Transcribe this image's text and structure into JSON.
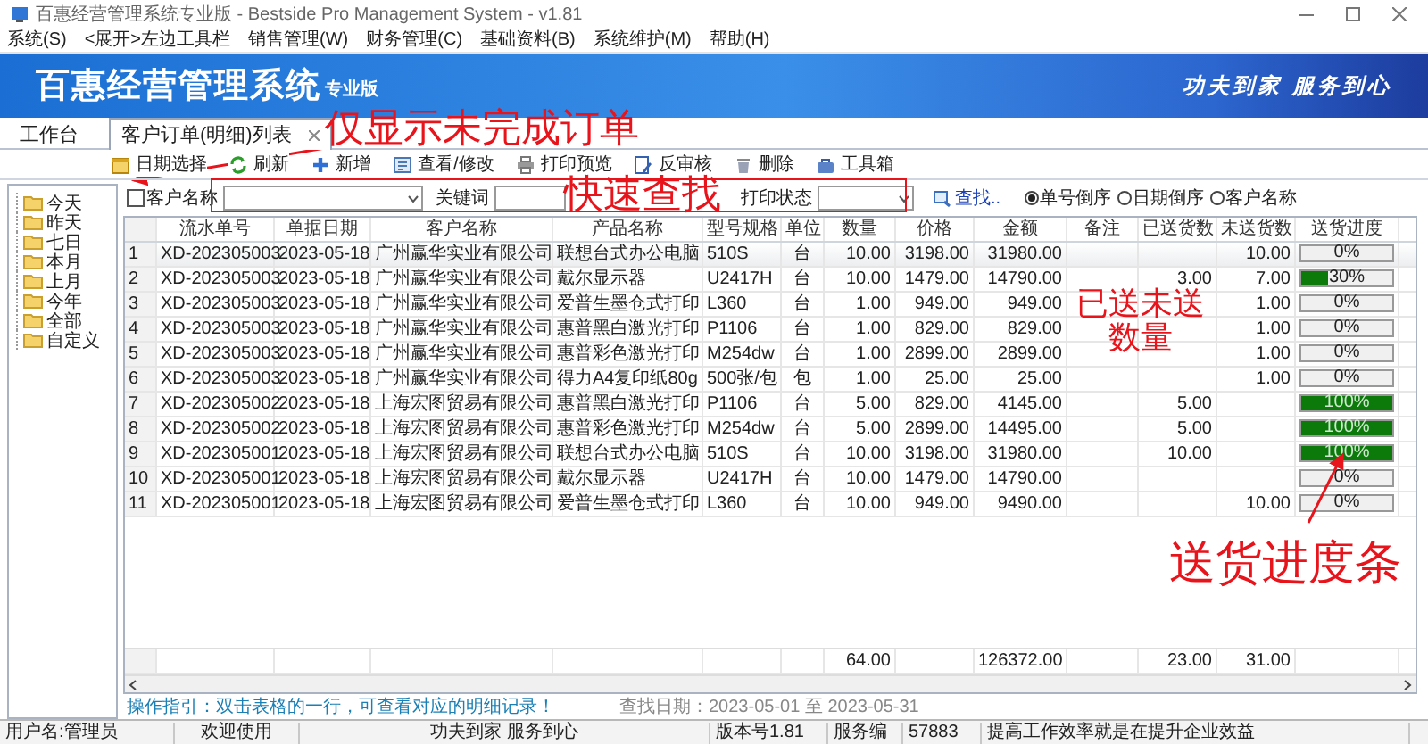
{
  "window": {
    "title": "百惠经营管理系统专业版 - Bestside Pro Management System - v1.81"
  },
  "menu": [
    "系统(S)",
    "<展开>左边工具栏",
    "销售管理(W)",
    "财务管理(C)",
    "基础资料(B)",
    "系统维护(M)",
    "帮助(H)"
  ],
  "banner": {
    "app_name": "百惠经营管理系统",
    "edition": "专业版",
    "slogan": "功夫到家 服务到心"
  },
  "tabs": [
    {
      "label": "工作台",
      "selected": false,
      "closable": false
    },
    {
      "label": "客户订单(明细)列表",
      "selected": true,
      "closable": true
    }
  ],
  "toolbar": [
    "日期选择",
    "刷新",
    "新增",
    "查看/修改",
    "打印预览",
    "反审核",
    "删除",
    "工具箱"
  ],
  "date_tree": [
    "今天",
    "昨天",
    "七日",
    "本月",
    "上月",
    "今年",
    "全部",
    "自定义"
  ],
  "filter": {
    "customer_checkbox": {
      "label": "客户名称",
      "checked": false
    },
    "keyword_label": "关键词",
    "print_status_label": "打印状态",
    "find_link": "查找..",
    "sort_options": [
      {
        "label": "单号倒序",
        "selected": true
      },
      {
        "label": "日期倒序",
        "selected": false
      },
      {
        "label": "客户名称",
        "selected": false
      }
    ]
  },
  "table": {
    "columns": [
      "流水单号",
      "单据日期",
      "客户名称",
      "产品名称",
      "型号规格",
      "单位",
      "数量",
      "价格",
      "金额",
      "备注",
      "已送货数",
      "未送货数",
      "送货进度"
    ],
    "rows": [
      {
        "no": "1",
        "order_no": "XD-202305003",
        "date": "2023-05-18",
        "customer": "广州赢华实业有限公司",
        "product": "联想台式办公电脑",
        "model": "510S",
        "unit": "台",
        "qty": "10.00",
        "price": "3198.00",
        "amount": "31980.00",
        "undelivered": "10.00",
        "progress": {
          "level": 0,
          "label": "0%"
        }
      },
      {
        "no": "2",
        "order_no": "XD-202305003",
        "date": "2023-05-18",
        "customer": "广州赢华实业有限公司",
        "product": "戴尔显示器",
        "model": "U2417H",
        "unit": "台",
        "qty": "10.00",
        "price": "1479.00",
        "amount": "14790.00",
        "delivered": "3.00",
        "undelivered": "7.00",
        "progress": {
          "level": 0.3,
          "label": "30%"
        }
      },
      {
        "no": "3",
        "order_no": "XD-202305003",
        "date": "2023-05-18",
        "customer": "广州赢华实业有限公司",
        "product": "爱普生墨仓式打印",
        "model": "L360",
        "unit": "台",
        "qty": "1.00",
        "price": "949.00",
        "amount": "949.00",
        "undelivered": "1.00",
        "progress": {
          "level": 0,
          "label": "0%"
        }
      },
      {
        "no": "4",
        "order_no": "XD-202305003",
        "date": "2023-05-18",
        "customer": "广州赢华实业有限公司",
        "product": "惠普黑白激光打印",
        "model": "P1106",
        "unit": "台",
        "qty": "1.00",
        "price": "829.00",
        "amount": "829.00",
        "undelivered": "1.00",
        "progress": {
          "level": 0,
          "label": "0%"
        }
      },
      {
        "no": "5",
        "order_no": "XD-202305003",
        "date": "2023-05-18",
        "customer": "广州赢华实业有限公司",
        "product": "惠普彩色激光打印",
        "model": "M254dw",
        "unit": "台",
        "qty": "1.00",
        "price": "2899.00",
        "amount": "2899.00",
        "undelivered": "1.00",
        "progress": {
          "level": 0,
          "label": "0%"
        }
      },
      {
        "no": "6",
        "order_no": "XD-202305003",
        "date": "2023-05-18",
        "customer": "广州赢华实业有限公司",
        "product": "得力A4复印纸80g",
        "model": "500张/包",
        "unit": "包",
        "qty": "1.00",
        "price": "25.00",
        "amount": "25.00",
        "undelivered": "1.00",
        "progress": {
          "level": 0,
          "label": "0%"
        }
      },
      {
        "no": "7",
        "order_no": "XD-202305002",
        "date": "2023-05-18",
        "customer": "上海宏图贸易有限公司",
        "product": "惠普黑白激光打印",
        "model": "P1106",
        "unit": "台",
        "qty": "5.00",
        "price": "829.00",
        "amount": "4145.00",
        "delivered": "5.00",
        "progress": {
          "level": 1,
          "label": "100%"
        }
      },
      {
        "no": "8",
        "order_no": "XD-202305002",
        "date": "2023-05-18",
        "customer": "上海宏图贸易有限公司",
        "product": "惠普彩色激光打印",
        "model": "M254dw",
        "unit": "台",
        "qty": "5.00",
        "price": "2899.00",
        "amount": "14495.00",
        "delivered": "5.00",
        "progress": {
          "level": 1,
          "label": "100%"
        }
      },
      {
        "no": "9",
        "order_no": "XD-202305001",
        "date": "2023-05-18",
        "customer": "上海宏图贸易有限公司",
        "product": "联想台式办公电脑",
        "model": "510S",
        "unit": "台",
        "qty": "10.00",
        "price": "3198.00",
        "amount": "31980.00",
        "delivered": "10.00",
        "progress": {
          "level": 1,
          "label": "100%"
        }
      },
      {
        "no": "10",
        "order_no": "XD-202305001",
        "date": "2023-05-18",
        "customer": "上海宏图贸易有限公司",
        "product": "戴尔显示器",
        "model": "U2417H",
        "unit": "台",
        "qty": "10.00",
        "price": "1479.00",
        "amount": "14790.00",
        "progress": {
          "level": 0,
          "label": "0%"
        }
      },
      {
        "no": "11",
        "order_no": "XD-202305001",
        "date": "2023-05-18",
        "customer": "上海宏图贸易有限公司",
        "product": "爱普生墨仓式打印",
        "model": "L360",
        "unit": "台",
        "qty": "10.00",
        "price": "949.00",
        "amount": "9490.00",
        "undelivered": "10.00",
        "progress": {
          "level": 0,
          "label": "0%"
        }
      }
    ],
    "totals": {
      "qty": "64.00",
      "amount": "126372.00",
      "delivered": "23.00",
      "undelivered": "31.00"
    }
  },
  "guide": {
    "hint": "操作指引：双击表格的一行，可查看对应的明细记录！",
    "date_range": "查找日期：2023-05-01 至 2023-05-31"
  },
  "status_bar": [
    "用户名:管理员",
    "欢迎使用",
    "功夫到家 服务到心",
    "版本号1.81",
    "服务编",
    "57883",
    "提高工作效率就是在提升企业效益"
  ],
  "annotations": [
    "仅显示未完成订单",
    "快速查找",
    "已送未送数量",
    "送货进度条"
  ]
}
